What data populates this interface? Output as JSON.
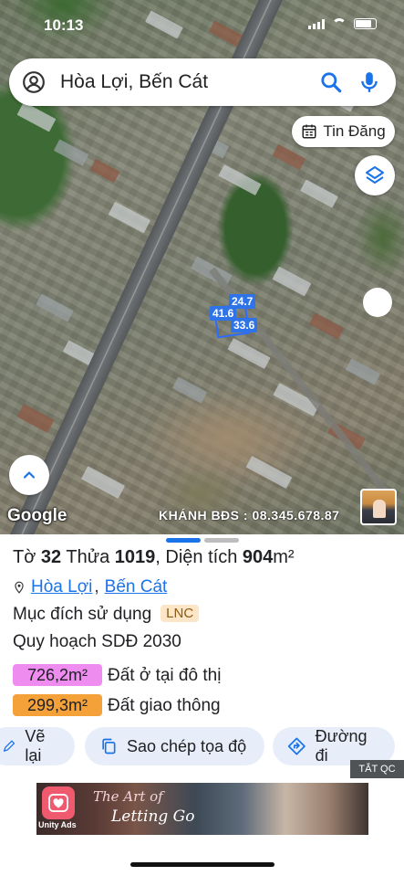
{
  "status_bar": {
    "time": "10:13"
  },
  "search": {
    "query": "Hòa Lợi, Bến Cát"
  },
  "map": {
    "tin_dang_label": "Tin Đăng",
    "dimensions": [
      "24.7",
      "41.6",
      "33.6"
    ],
    "google_logo": "Google",
    "watermark": "KHÁNH BĐS : 08.345.678.87"
  },
  "parcel": {
    "title_prefix": "Tờ",
    "sheet": "32",
    "plot_label": "Thửa",
    "plot": "1019",
    "area_label": ", Diện tích",
    "area": "904",
    "area_unit": "m²",
    "location_ward": "Hòa Lợi",
    "location_sep": ",",
    "location_district": "Bến Cát",
    "purpose_label": "Mục đích sử dụng",
    "purpose_code": "LNC",
    "plan_label": "Quy hoạch SDĐ 2030",
    "zones": [
      {
        "area": "726,2m²",
        "label": "Đất ở tại đô thị",
        "color": "#ee8cf0"
      },
      {
        "area": "299,3m²",
        "label": "Đất giao thông",
        "color": "#f4a13a"
      }
    ]
  },
  "actions": {
    "redraw": "Vẽ lại",
    "copy_coords": "Sao chép tọa độ",
    "directions": "Đường đi"
  },
  "ad": {
    "hide_label": "TẮT QC",
    "title_line1": "The Art of",
    "title_line2": "Letting Go",
    "network": "Unity Ads"
  }
}
